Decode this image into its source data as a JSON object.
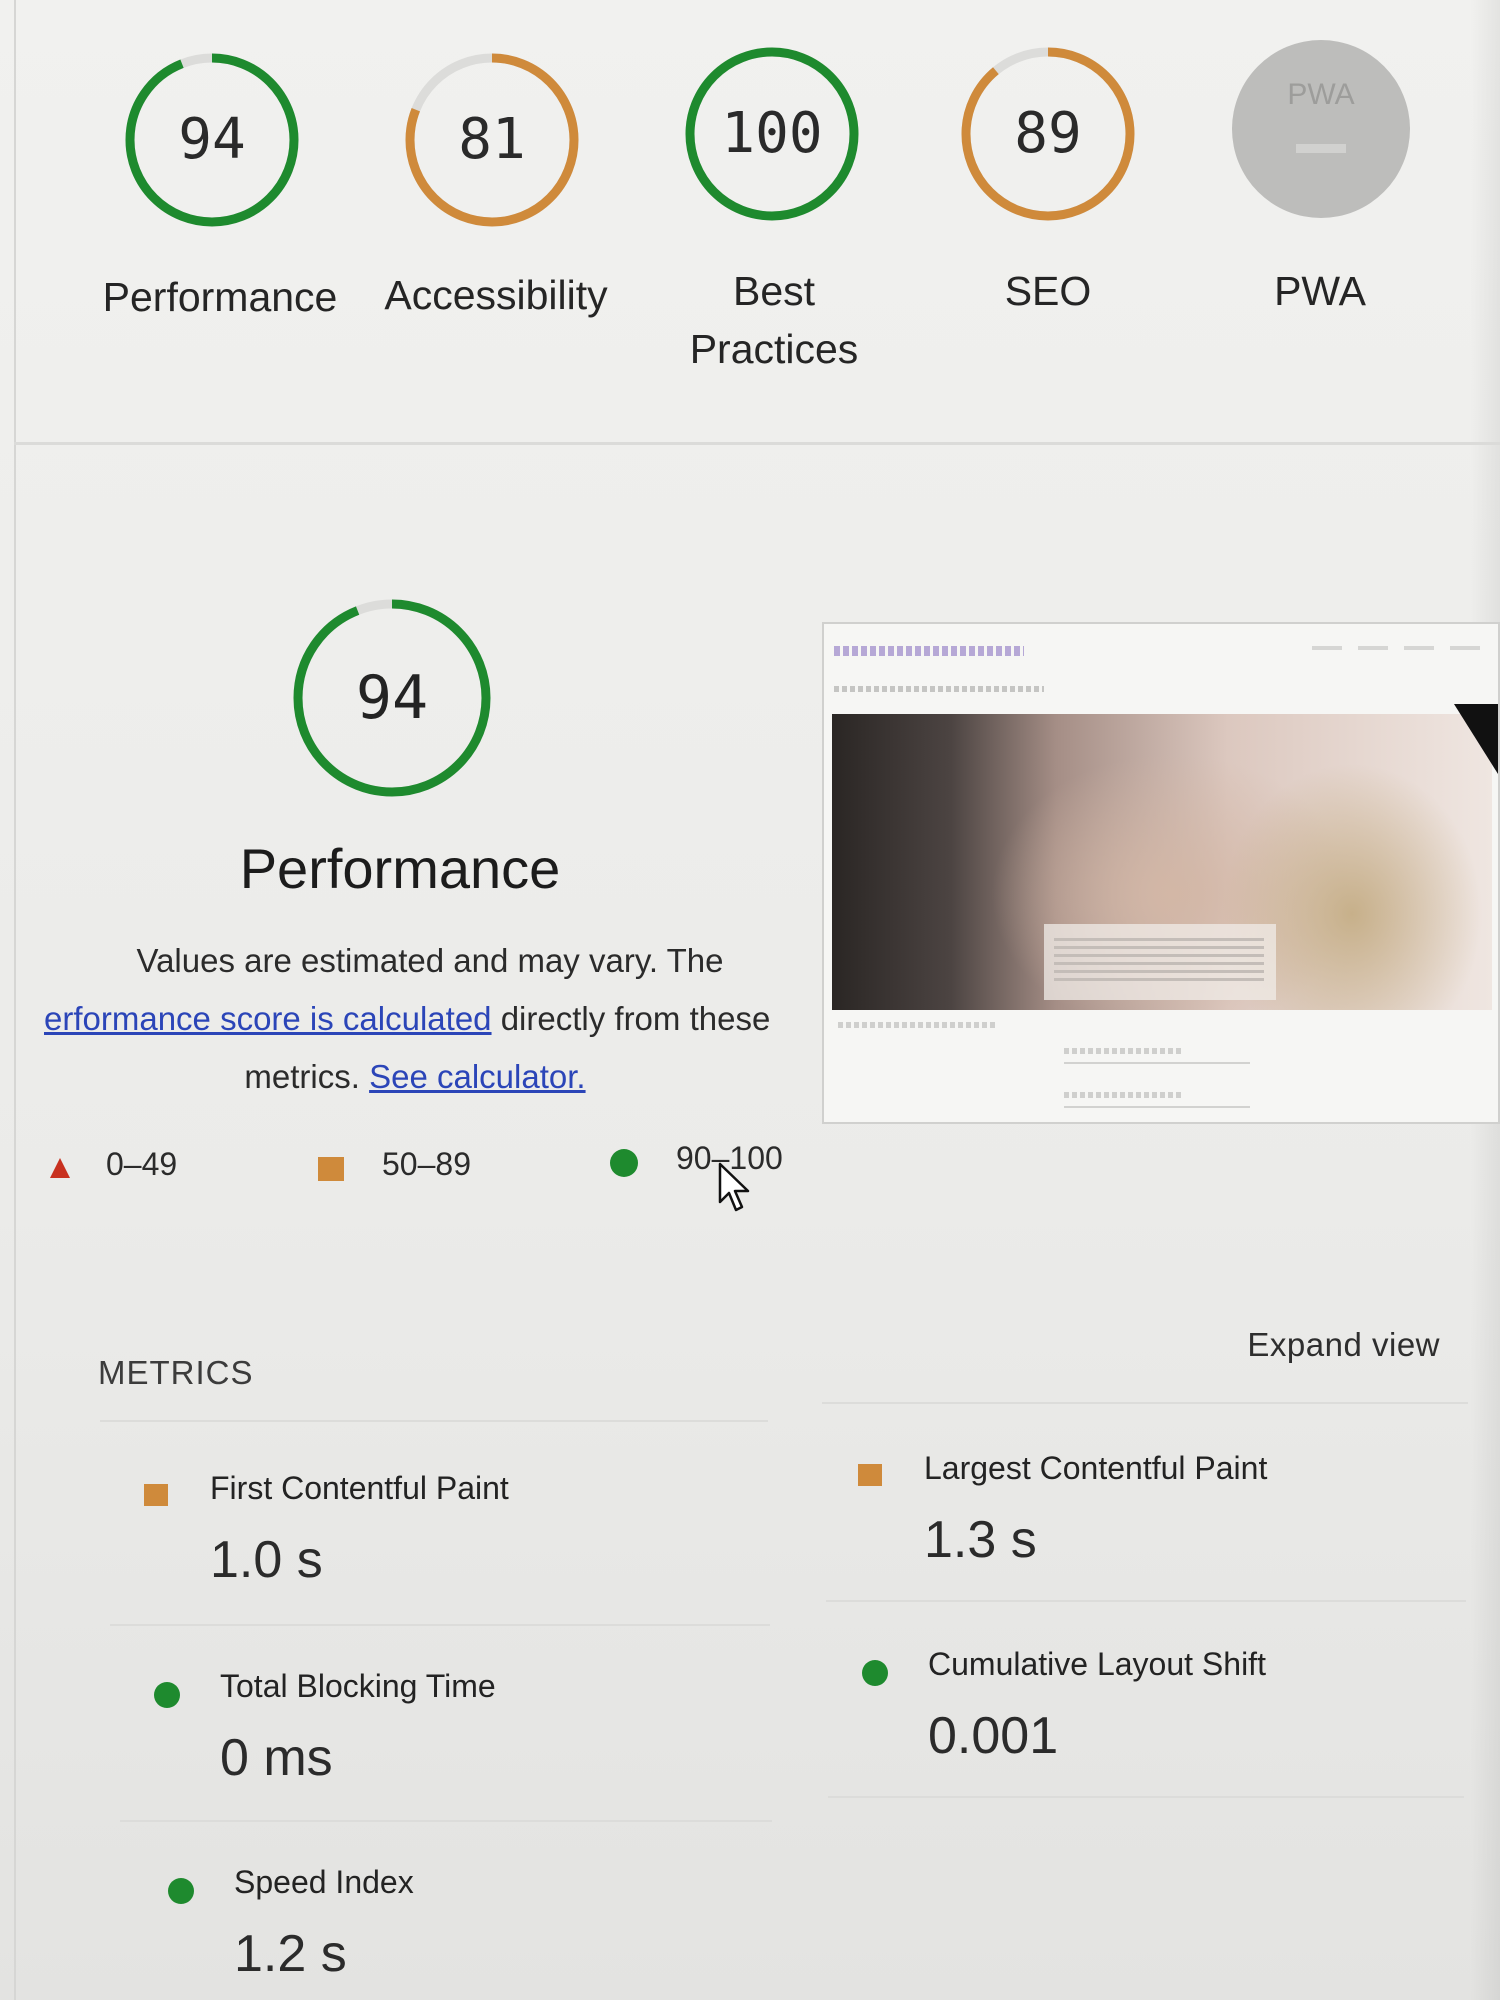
{
  "categories": [
    {
      "name": "Performance",
      "score": 94,
      "status": "pass",
      "color": "#1e8a2e"
    },
    {
      "name": "Accessibility",
      "score": 81,
      "status": "average",
      "color": "#cf8a3b"
    },
    {
      "name": "Best Practices",
      "score": 100,
      "status": "pass",
      "color": "#1e8a2e"
    },
    {
      "name": "SEO",
      "score": 89,
      "status": "average",
      "color": "#cf8a3b"
    },
    {
      "name": "PWA",
      "badge_text": "PWA",
      "status": "not-applicable",
      "color": "#bdbdbb"
    }
  ],
  "performance": {
    "score": 94,
    "title": "Performance",
    "desc_part1": "Values are estimated and may vary. The",
    "desc_link": "erformance score is calculated",
    "desc_part2": " directly from these",
    "desc_part3": "metrics. ",
    "calculator_link": "See calculator."
  },
  "legend": {
    "fail": "0–49",
    "average": "50–89",
    "pass": "90–100"
  },
  "metrics": {
    "header": "METRICS",
    "expand_label": "Expand view",
    "items": [
      {
        "label": "First Contentful Paint",
        "value": "1.0 s",
        "status": "average"
      },
      {
        "label": "Largest Contentful Paint",
        "value": "1.3 s",
        "status": "average"
      },
      {
        "label": "Total Blocking Time",
        "value": "0 ms",
        "status": "pass"
      },
      {
        "label": "Cumulative Layout Shift",
        "value": "0.001",
        "status": "pass"
      },
      {
        "label": "Speed Index",
        "value": "1.2 s",
        "status": "pass"
      }
    ]
  },
  "colors": {
    "pass": "#1e8a2e",
    "average": "#cf8a3b",
    "fail": "#c8311f",
    "link": "#2b45b8"
  },
  "icons": {
    "fail": "red-triangle-icon",
    "average": "orange-square-icon",
    "pass": "green-circle-icon",
    "cursor": "mouse-pointer-icon"
  }
}
